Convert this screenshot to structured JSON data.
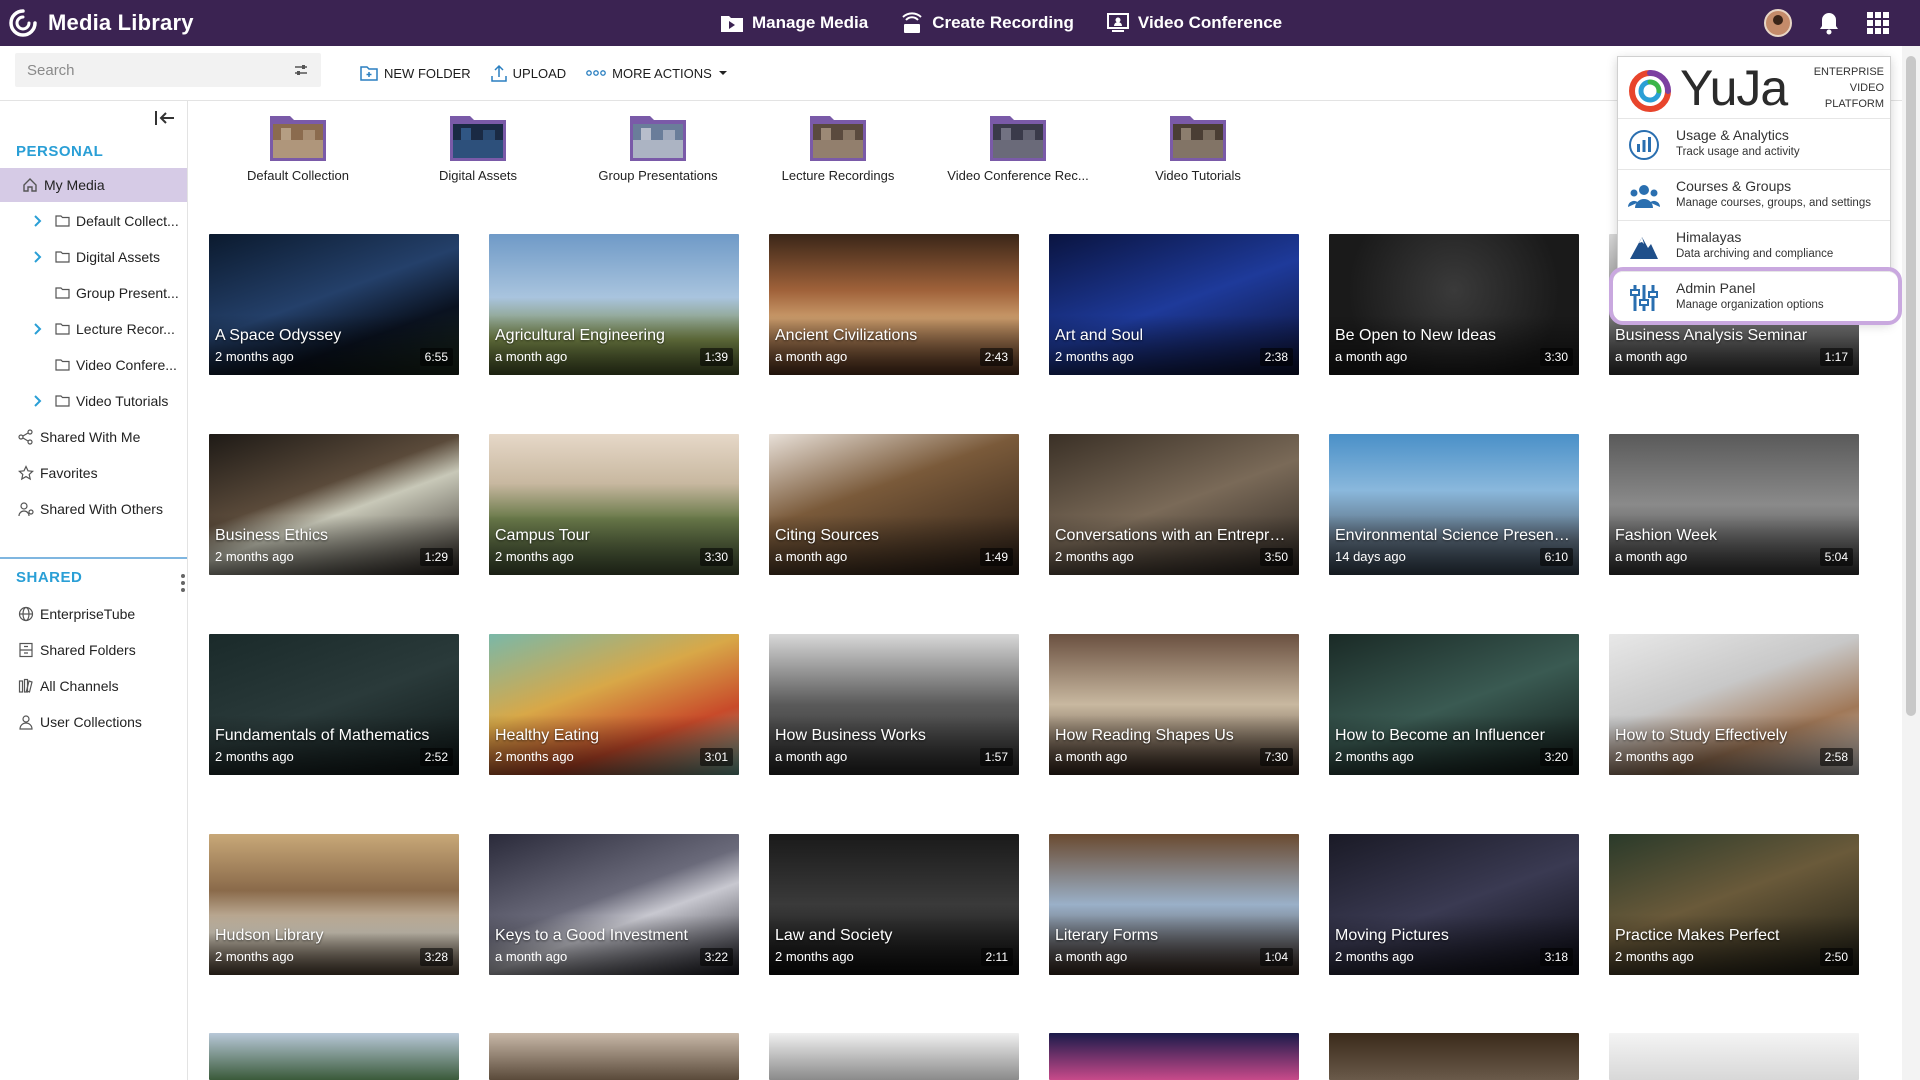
{
  "app": {
    "title": "Media Library"
  },
  "topnav": {
    "manage_media": "Manage Media",
    "create_recording": "Create Recording",
    "video_conference": "Video Conference"
  },
  "search": {
    "placeholder": "Search"
  },
  "actions": {
    "new_folder": "NEW FOLDER",
    "upload": "UPLOAD",
    "more_actions": "MORE ACTIONS"
  },
  "sidebar": {
    "personal_heading": "PERSONAL",
    "shared_heading": "SHARED",
    "personal_items": [
      {
        "label": "My Media"
      },
      {
        "label": "Default Collect..."
      },
      {
        "label": "Digital Assets"
      },
      {
        "label": "Group Present..."
      },
      {
        "label": "Lecture Recor..."
      },
      {
        "label": "Video Confere..."
      },
      {
        "label": "Video Tutorials"
      },
      {
        "label": "Shared With Me"
      },
      {
        "label": "Favorites"
      },
      {
        "label": "Shared With Others"
      }
    ],
    "shared_items": [
      {
        "label": "EnterpriseTube"
      },
      {
        "label": "Shared Folders"
      },
      {
        "label": "All Channels"
      },
      {
        "label": "User Collections"
      }
    ]
  },
  "folders": [
    {
      "name": "Default Collection"
    },
    {
      "name": "Digital Assets"
    },
    {
      "name": "Group Presentations"
    },
    {
      "name": "Lecture Recordings"
    },
    {
      "name": "Video Conference Rec..."
    },
    {
      "name": "Video Tutorials"
    }
  ],
  "videos": [
    {
      "title": "A Space Odyssey",
      "age": "2 months ago",
      "duration": "6:55"
    },
    {
      "title": "Agricultural Engineering",
      "age": "a month ago",
      "duration": "1:39"
    },
    {
      "title": "Ancient Civilizations",
      "age": "a month ago",
      "duration": "2:43"
    },
    {
      "title": "Art and Soul",
      "age": "2 months ago",
      "duration": "2:38"
    },
    {
      "title": "Be Open to New Ideas",
      "age": "a month ago",
      "duration": "3:30"
    },
    {
      "title": "Business Analysis Seminar",
      "age": "a month ago",
      "duration": "1:17"
    },
    {
      "title": "Business Ethics",
      "age": "2 months ago",
      "duration": "1:29"
    },
    {
      "title": "Campus Tour",
      "age": "2 months ago",
      "duration": "3:30"
    },
    {
      "title": "Citing Sources",
      "age": "a month ago",
      "duration": "1:49"
    },
    {
      "title": "Conversations with an Entrepren...",
      "age": "2 months ago",
      "duration": "3:50"
    },
    {
      "title": "Environmental Science Presentat...",
      "age": "14 days ago",
      "duration": "6:10"
    },
    {
      "title": "Fashion Week",
      "age": "a month ago",
      "duration": "5:04"
    },
    {
      "title": "Fundamentals of Mathematics",
      "age": "2 months ago",
      "duration": "2:52"
    },
    {
      "title": "Healthy Eating",
      "age": "2 months ago",
      "duration": "3:01"
    },
    {
      "title": "How Business Works",
      "age": "a month ago",
      "duration": "1:57"
    },
    {
      "title": "How Reading Shapes Us",
      "age": "a month ago",
      "duration": "7:30"
    },
    {
      "title": "How to Become an Influencer",
      "age": "2 months ago",
      "duration": "3:20"
    },
    {
      "title": "How to Study Effectively",
      "age": "2 months ago",
      "duration": "2:58"
    },
    {
      "title": "Hudson Library",
      "age": "2 months ago",
      "duration": "3:28"
    },
    {
      "title": "Keys to a Good Investment",
      "age": "a month ago",
      "duration": "3:22"
    },
    {
      "title": "Law and Society",
      "age": "2 months ago",
      "duration": "2:11"
    },
    {
      "title": "Literary Forms",
      "age": "a month ago",
      "duration": "1:04"
    },
    {
      "title": "Moving Pictures",
      "age": "2 months ago",
      "duration": "3:18"
    },
    {
      "title": "Practice Makes Perfect",
      "age": "2 months ago",
      "duration": "2:50"
    }
  ],
  "dropdown": {
    "brand": "YuJa",
    "tagline_1": "ENTERPRISE",
    "tagline_2": "VIDEO",
    "tagline_3": "PLATFORM",
    "items": [
      {
        "title": "Usage & Analytics",
        "subtitle": "Track usage and activity",
        "icon": "analytics-icon"
      },
      {
        "title": "Courses & Groups",
        "subtitle": "Manage courses, groups, and settings",
        "icon": "groups-icon"
      },
      {
        "title": "Himalayas",
        "subtitle": "Data archiving and compliance",
        "icon": "mountain-icon"
      },
      {
        "title": "Admin Panel",
        "subtitle": "Manage organization options",
        "icon": "sliders-icon"
      }
    ]
  },
  "colors": {
    "topbar": "#3b2352",
    "accent": "#2a9fd6",
    "active_item": "#d6cbe6",
    "folder": "#7a5aa8"
  }
}
